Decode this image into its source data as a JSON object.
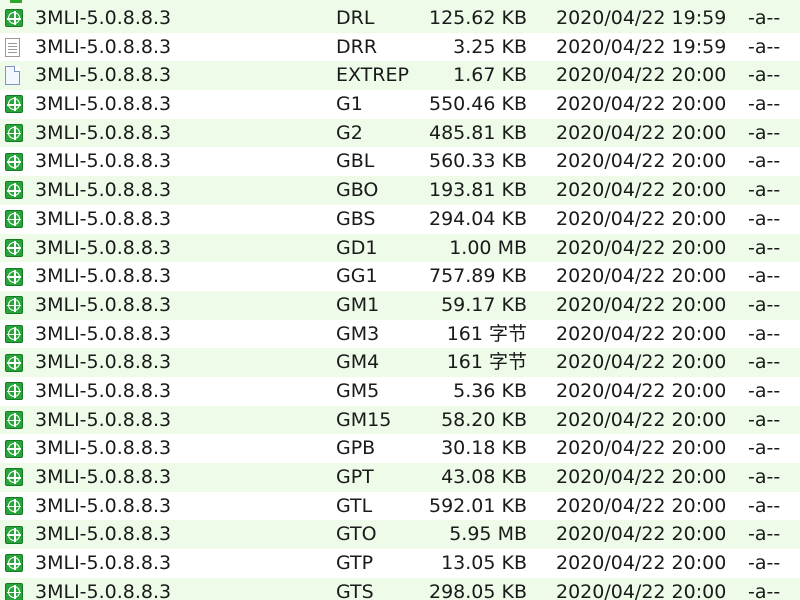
{
  "colors": {
    "alt_row": "#eefbe9",
    "icon_green": "#27a43a"
  },
  "files": [
    {
      "icon": "green-crosshair-icon",
      "name": "3MLI-5.0.8.8.3",
      "ext": "DRL",
      "size": "125.62 KB",
      "date": "2020/04/22 19:59",
      "attr": "-a--"
    },
    {
      "icon": "text-file-icon",
      "name": "3MLI-5.0.8.8.3",
      "ext": "DRR",
      "size": "3.25 KB",
      "date": "2020/04/22 19:59",
      "attr": "-a--"
    },
    {
      "icon": "blank-file-icon",
      "name": "3MLI-5.0.8.8.3",
      "ext": "EXTREP",
      "size": "1.67 KB",
      "date": "2020/04/22 20:00",
      "attr": "-a--"
    },
    {
      "icon": "green-crosshair-icon",
      "name": "3MLI-5.0.8.8.3",
      "ext": "G1",
      "size": "550.46 KB",
      "date": "2020/04/22 20:00",
      "attr": "-a--"
    },
    {
      "icon": "green-crosshair-icon",
      "name": "3MLI-5.0.8.8.3",
      "ext": "G2",
      "size": "485.81 KB",
      "date": "2020/04/22 20:00",
      "attr": "-a--"
    },
    {
      "icon": "green-crosshair-icon",
      "name": "3MLI-5.0.8.8.3",
      "ext": "GBL",
      "size": "560.33 KB",
      "date": "2020/04/22 20:00",
      "attr": "-a--"
    },
    {
      "icon": "green-crosshair-icon",
      "name": "3MLI-5.0.8.8.3",
      "ext": "GBO",
      "size": "193.81 KB",
      "date": "2020/04/22 20:00",
      "attr": "-a--"
    },
    {
      "icon": "green-crosshair-icon",
      "name": "3MLI-5.0.8.8.3",
      "ext": "GBS",
      "size": "294.04 KB",
      "date": "2020/04/22 20:00",
      "attr": "-a--"
    },
    {
      "icon": "green-crosshair-icon",
      "name": "3MLI-5.0.8.8.3",
      "ext": "GD1",
      "size": "1.00 MB",
      "date": "2020/04/22 20:00",
      "attr": "-a--"
    },
    {
      "icon": "green-crosshair-icon",
      "name": "3MLI-5.0.8.8.3",
      "ext": "GG1",
      "size": "757.89 KB",
      "date": "2020/04/22 20:00",
      "attr": "-a--"
    },
    {
      "icon": "green-crosshair-icon",
      "name": "3MLI-5.0.8.8.3",
      "ext": "GM1",
      "size": "59.17 KB",
      "date": "2020/04/22 20:00",
      "attr": "-a--"
    },
    {
      "icon": "green-crosshair-icon",
      "name": "3MLI-5.0.8.8.3",
      "ext": "GM3",
      "size": "161 字节",
      "date": "2020/04/22 20:00",
      "attr": "-a--"
    },
    {
      "icon": "green-crosshair-icon",
      "name": "3MLI-5.0.8.8.3",
      "ext": "GM4",
      "size": "161 字节",
      "date": "2020/04/22 20:00",
      "attr": "-a--"
    },
    {
      "icon": "green-crosshair-icon",
      "name": "3MLI-5.0.8.8.3",
      "ext": "GM5",
      "size": "5.36 KB",
      "date": "2020/04/22 20:00",
      "attr": "-a--"
    },
    {
      "icon": "green-crosshair-icon",
      "name": "3MLI-5.0.8.8.3",
      "ext": "GM15",
      "size": "58.20 KB",
      "date": "2020/04/22 20:00",
      "attr": "-a--"
    },
    {
      "icon": "green-crosshair-icon",
      "name": "3MLI-5.0.8.8.3",
      "ext": "GPB",
      "size": "30.18 KB",
      "date": "2020/04/22 20:00",
      "attr": "-a--"
    },
    {
      "icon": "green-crosshair-icon",
      "name": "3MLI-5.0.8.8.3",
      "ext": "GPT",
      "size": "43.08 KB",
      "date": "2020/04/22 20:00",
      "attr": "-a--"
    },
    {
      "icon": "green-crosshair-icon",
      "name": "3MLI-5.0.8.8.3",
      "ext": "GTL",
      "size": "592.01 KB",
      "date": "2020/04/22 20:00",
      "attr": "-a--"
    },
    {
      "icon": "green-crosshair-icon",
      "name": "3MLI-5.0.8.8.3",
      "ext": "GTO",
      "size": "5.95 MB",
      "date": "2020/04/22 20:00",
      "attr": "-a--"
    },
    {
      "icon": "green-crosshair-icon",
      "name": "3MLI-5.0.8.8.3",
      "ext": "GTP",
      "size": "13.05 KB",
      "date": "2020/04/22 20:00",
      "attr": "-a--"
    },
    {
      "icon": "green-crosshair-icon",
      "name": "3MLI-5.0.8.8.3",
      "ext": "GTS",
      "size": "298.05 KB",
      "date": "2020/04/22 20:00",
      "attr": "-a--"
    }
  ]
}
